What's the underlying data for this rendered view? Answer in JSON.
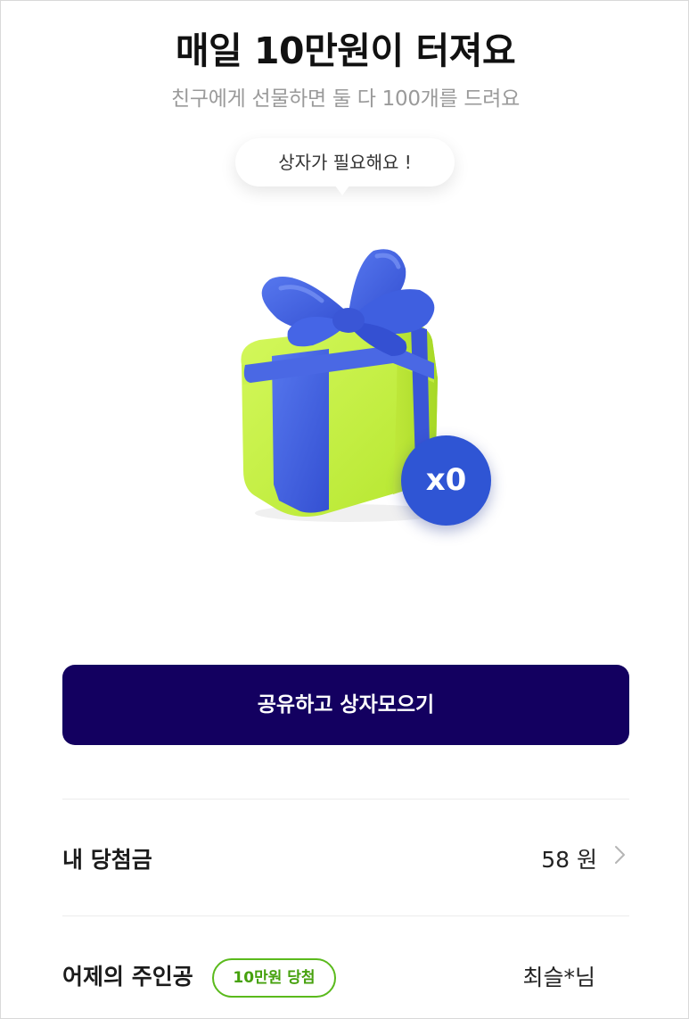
{
  "header": {
    "title": "매일 10만원이 터져요",
    "subtitle": "친구에게 선물하면 둘 다 100개를 드려요"
  },
  "speech_bubble": {
    "text": "상자가 필요해요 !"
  },
  "gift": {
    "icon": "gift-box-icon",
    "box_color": "#c6f24a",
    "ribbon_color": "#3f5fe0",
    "count_badge": "x0",
    "count_value": 0
  },
  "share_button": {
    "label": "공유하고 상자모으기",
    "color": "#130060"
  },
  "winnings": {
    "label": "내 당첨금",
    "value": "58 원"
  },
  "yesterday": {
    "label": "어제의 주인공",
    "badge": "10만원 당첨",
    "winner": "최슬*님"
  }
}
